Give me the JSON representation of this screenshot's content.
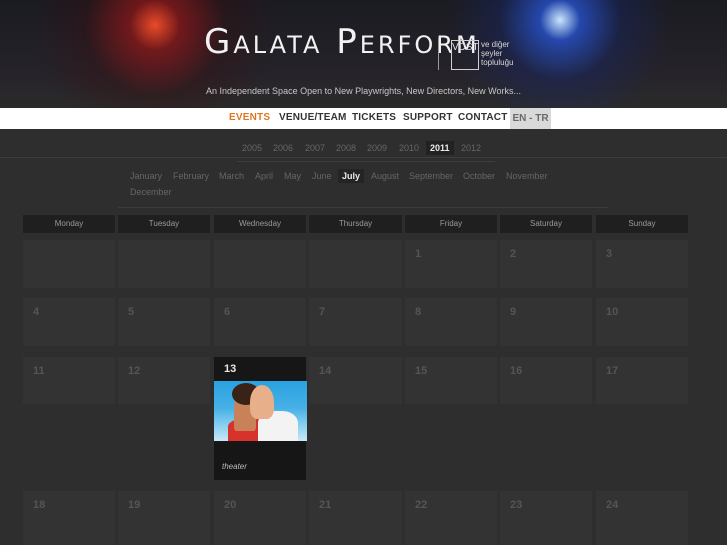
{
  "brand": {
    "name": "Galata Perform",
    "partner_logo": "VDST",
    "partner_text": "ve diğer şeyler topluluğu"
  },
  "tagline": "An Independent Space Open to New Playwrights, New Directors, New Works...",
  "nav": {
    "items": [
      "EVENTS",
      "VENUE/TEAM",
      "TICKETS",
      "SUPPORT",
      "CONTACT"
    ],
    "active": "EVENTS",
    "language": "EN - TR"
  },
  "years": [
    "2005",
    "2006",
    "2007",
    "2008",
    "2009",
    "2010",
    "2011",
    "2012"
  ],
  "selected_year": "2011",
  "months": [
    "January",
    "February",
    "March",
    "April",
    "May",
    "June",
    "July",
    "August",
    "September",
    "October",
    "November",
    "December"
  ],
  "selected_month": "July",
  "weekdays": [
    "Monday",
    "Tuesday",
    "Wednesday",
    "Thursday",
    "Friday",
    "Saturday",
    "Sunday"
  ],
  "calendar_rows": [
    [
      "",
      "",
      "",
      "",
      "1",
      "2",
      "3"
    ],
    [
      "4",
      "5",
      "6",
      "7",
      "8",
      "9",
      "10"
    ],
    [
      "11",
      "12",
      "13",
      "14",
      "15",
      "16",
      "17"
    ],
    [
      "18",
      "19",
      "20",
      "21",
      "22",
      "23",
      "24"
    ]
  ],
  "event": {
    "day": "13",
    "category": "theater"
  },
  "colors": {
    "accent": "#e0771e",
    "background": "#2e2e2e",
    "cell": "#333333",
    "event_cell": "#161616"
  }
}
